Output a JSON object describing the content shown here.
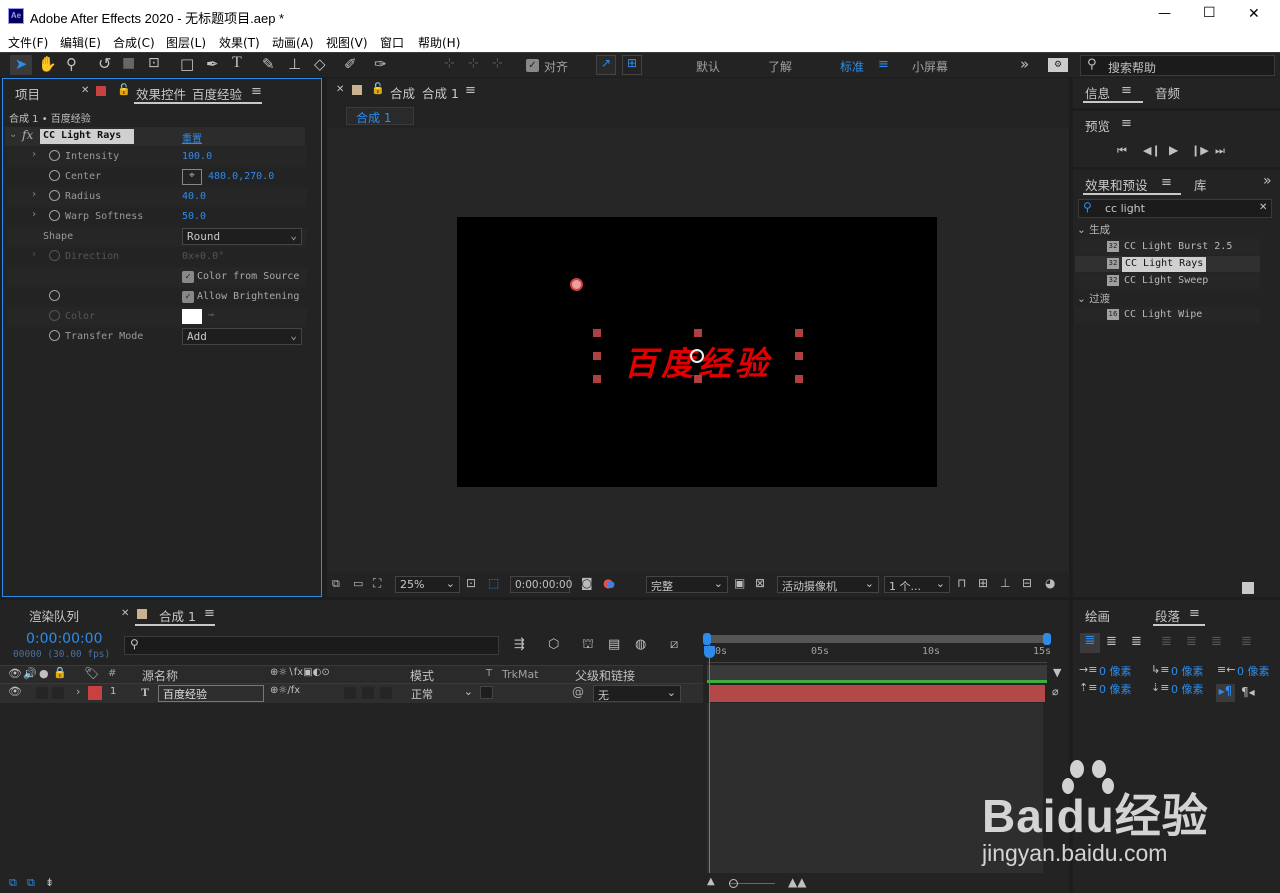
{
  "window": {
    "app_icon": "Ae",
    "title": "Adobe After Effects 2020 - 无标题项目.aep *",
    "minimize": "—",
    "maximize": "☐",
    "close": "✕"
  },
  "menu": [
    "文件(F)",
    "编辑(E)",
    "合成(C)",
    "图层(L)",
    "效果(T)",
    "动画(A)",
    "视图(V)",
    "窗口",
    "帮助(H)"
  ],
  "toolbar": {
    "snap_label": "对齐",
    "workspaces": [
      "默认",
      "了解",
      "标准",
      "小屏幕"
    ],
    "active_workspace": "标准",
    "more": "»",
    "search_placeholder": "搜索帮助"
  },
  "left_panel": {
    "tab_project": "项目",
    "tab_effect_controls": "效果控件",
    "tab_effect_layer": "百度经验",
    "breadcrumb": "合成 1 • 百度经验",
    "effect_name": "CC Light Rays",
    "reset_label": "重置",
    "properties": [
      {
        "name": "Intensity",
        "value": "100.0"
      },
      {
        "name": "Center",
        "value": "480.0,270.0"
      },
      {
        "name": "Radius",
        "value": "40.0"
      },
      {
        "name": "Warp Softness",
        "value": "50.0"
      },
      {
        "name": "Shape",
        "value": "Round"
      },
      {
        "name": "Direction",
        "value": "0x+0.0°"
      },
      {
        "name": "Color from Source",
        "value": ""
      },
      {
        "name": "Allow Brightening",
        "value": ""
      },
      {
        "name": "Color",
        "value": ""
      },
      {
        "name": "Transfer Mode",
        "value": "Add"
      }
    ]
  },
  "viewer": {
    "tab_label": "合成",
    "tab_comp": "合成 1",
    "sub_tab": "合成 1",
    "canvas_text": "百度经验",
    "zoom": "25%",
    "timecode": "0:00:00:00",
    "resolution": "完整",
    "camera": "活动摄像机",
    "views": "1 个..."
  },
  "right_panel": {
    "tab_info": "信息",
    "tab_audio": "音频",
    "preview_label": "预览",
    "tab_effects_presets": "效果和预设",
    "tab_library": "库",
    "search_value": "cc light",
    "categories": [
      {
        "name": "生成",
        "items": [
          "CC Light Burst 2.5",
          "CC Light Rays",
          "CC Light Sweep"
        ]
      },
      {
        "name": "过渡",
        "items": [
          "CC Light Wipe"
        ]
      }
    ],
    "selected_item": "CC Light Rays",
    "tab_paint": "绘画",
    "tab_paragraph": "段落",
    "para_values": [
      "0 像素",
      "0 像素",
      "0 像素",
      "0 像素",
      "0 像素"
    ]
  },
  "timeline": {
    "tab_render_queue": "渲染队列",
    "tab_comp": "合成 1",
    "timecode": "0:00:00:00",
    "frames_fps": "00000 (30.00 fps)",
    "columns": {
      "num": "#",
      "source_name": "源名称",
      "mode": "模式",
      "t": "T",
      "trkmat": "TrkMat",
      "parent": "父级和链接"
    },
    "layer": {
      "index": "1",
      "type": "T",
      "name": "百度经验",
      "mode": "正常",
      "parent": "无"
    },
    "ruler": [
      "00s",
      "05s",
      "10s",
      "15s"
    ]
  },
  "watermark": {
    "brand": "Baidu经验",
    "url": "jingyan.baidu.com"
  },
  "colors": {
    "accent": "#2d8ceb",
    "layer_label": "#c94040",
    "track_bar": "#b34848",
    "canvas_text": "#e00000",
    "panel_focus": "#2d8ceb"
  }
}
